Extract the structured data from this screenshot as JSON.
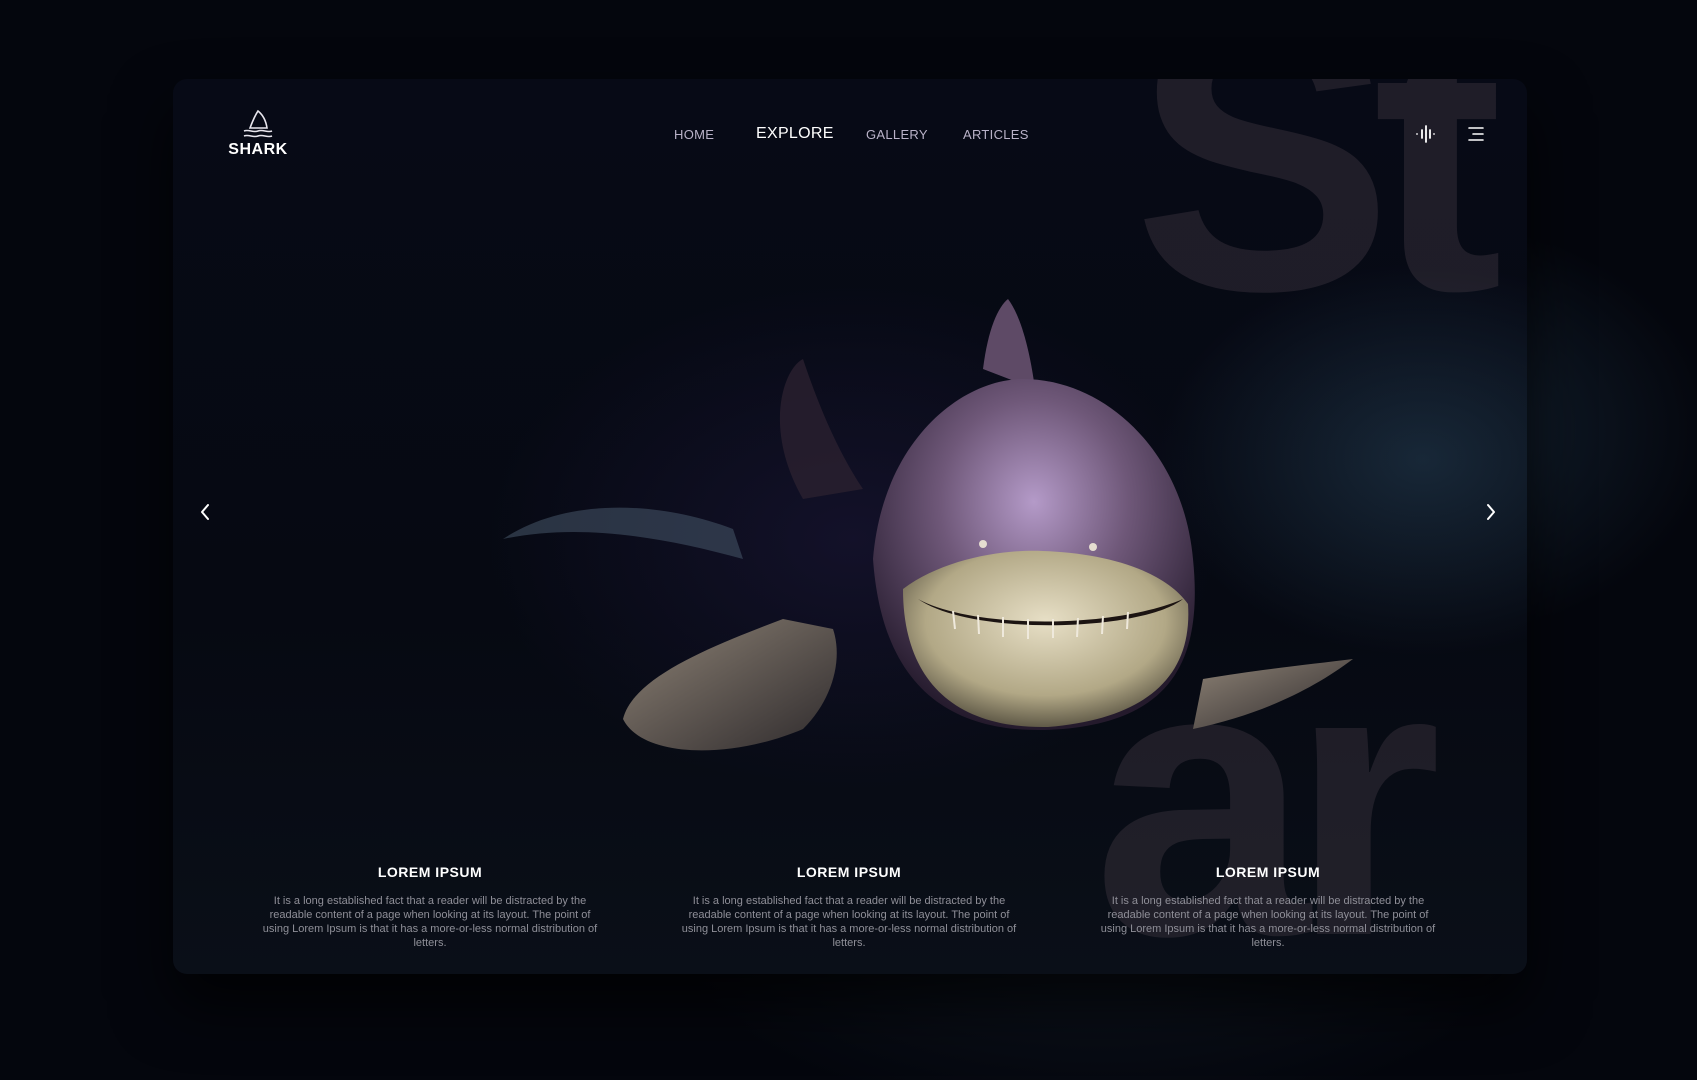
{
  "brand": {
    "name": "SHARK",
    "icon": "shark-fin-icon"
  },
  "nav": {
    "items": [
      {
        "label": "HOME"
      },
      {
        "label": "EXPLORE",
        "active": true
      },
      {
        "label": "GALLERY"
      },
      {
        "label": "ARTICLES"
      }
    ]
  },
  "header_icons": {
    "audio": "audio-wave-icon",
    "menu": "hamburger-menu-icon"
  },
  "background_word": {
    "top": "St",
    "bottom": "ar"
  },
  "carousel": {
    "prev": "‹",
    "next": "›"
  },
  "cards": [
    {
      "title": "LOREM IPSUM",
      "body": "It is a long established fact that a reader will be distracted by the readable content of a page when looking at its layout. The point of using Lorem Ipsum is that it has a more-or-less normal distribution of letters."
    },
    {
      "title": "LOREM IPSUM",
      "body": "It is a long established fact that a reader will be distracted by the readable content of a page when looking at its layout. The point of using Lorem Ipsum is that it has a more-or-less normal distribution of letters."
    },
    {
      "title": "LOREM IPSUM",
      "body": "It is a long established fact that a reader will be distracted by the readable content of a page when looking at its layout. The point of using Lorem Ipsum is that it has a more-or-less normal distribution of letters."
    }
  ],
  "colors": {
    "background": "#05070f",
    "text": "#ffffff",
    "nav_inactive": "#b9b2c8",
    "body_text": "#8f8f98"
  }
}
